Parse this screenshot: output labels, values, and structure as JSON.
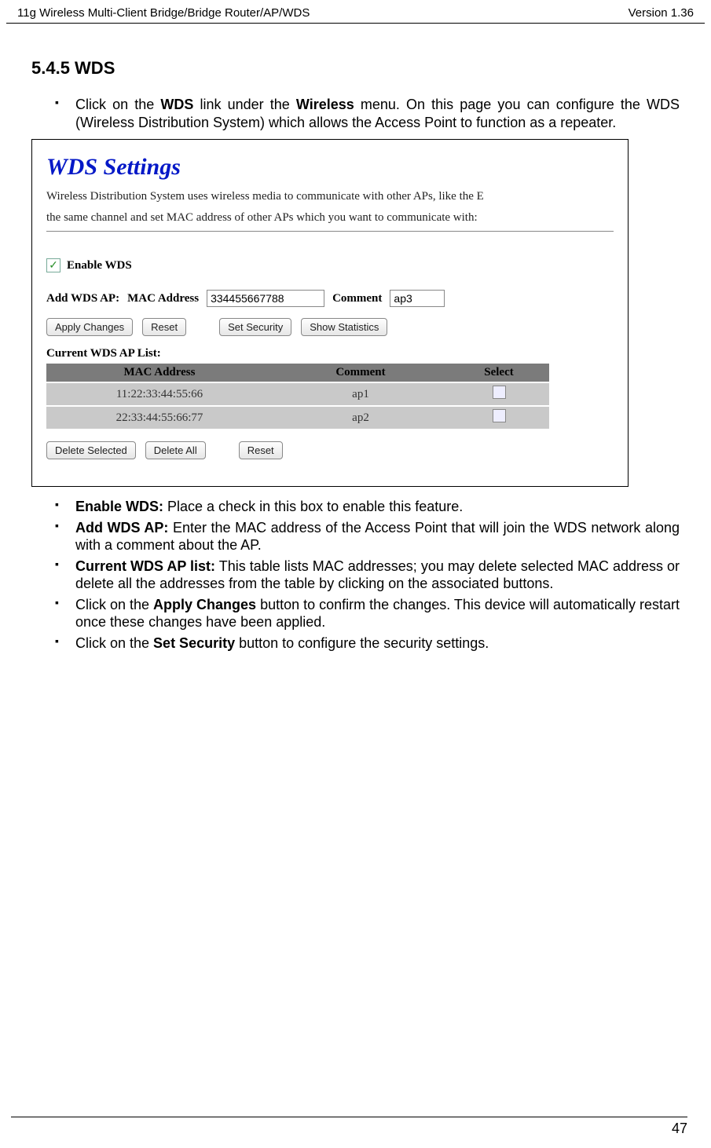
{
  "header": {
    "left": "11g Wireless Multi-Client Bridge/Bridge Router/AP/WDS",
    "right": "Version 1.36"
  },
  "section_heading": "5.4.5  WDS",
  "intro": {
    "prefix": "Click on the ",
    "wds": "WDS",
    "mid": " link under the ",
    "wireless": "Wireless",
    "suffix": " menu. On this page you can configure the WDS (Wireless Distribution System) which allows the Access Point to function as a repeater."
  },
  "shot": {
    "title": "WDS Settings",
    "desc1": "Wireless Distribution System uses wireless media to communicate with other APs, like the E",
    "desc2": "the same channel and set MAC address of other APs which you want to communicate with:",
    "enable_label": "Enable WDS",
    "add_label": "Add WDS AP:",
    "mac_label": "MAC Address",
    "mac_value": "334455667788",
    "comment_label": "Comment",
    "comment_value": "ap3",
    "buttons": {
      "apply": "Apply Changes",
      "reset": "Reset",
      "set_security": "Set Security",
      "show_stats": "Show Statistics",
      "delete_selected": "Delete Selected",
      "delete_all": "Delete All",
      "reset2": "Reset"
    },
    "list_title": "Current WDS AP List:",
    "table": {
      "headers": {
        "mac": "MAC Address",
        "comment": "Comment",
        "select": "Select"
      },
      "rows": [
        {
          "mac": "11:22:33:44:55:66",
          "comment": "ap1"
        },
        {
          "mac": "22:33:44:55:66:77",
          "comment": "ap2"
        }
      ]
    }
  },
  "bullets_after": {
    "b1_label": "Enable WDS:",
    "b1_text": " Place a check in this box to enable this feature.",
    "b2_label": "Add WDS AP:",
    "b2_text": " Enter the MAC address of the Access Point that will join the WDS network along with a comment about the AP.",
    "b3_label": "Current WDS AP list:",
    "b3_text": " This table lists MAC addresses; you may delete selected MAC address or delete all the addresses from the table by clicking on the associated buttons.",
    "b4_pre": "Click on the ",
    "b4_label": "Apply Changes",
    "b4_text": " button to confirm the changes. This device will automatically restart once these changes have been applied.",
    "b5_pre": "Click on the ",
    "b5_label": "Set Security",
    "b5_text": " button to configure the security settings."
  },
  "page_number": "47"
}
